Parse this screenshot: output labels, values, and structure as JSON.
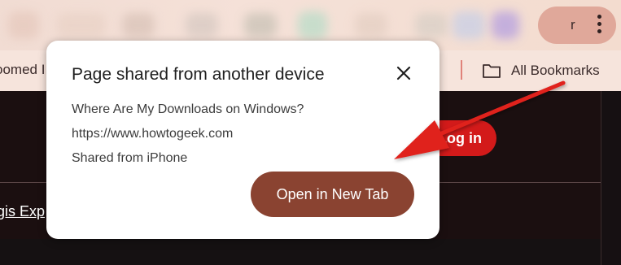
{
  "toolbar": {
    "profile_letter": "r",
    "menu_icon": "kebab-menu-icon"
  },
  "bookmarks_bar": {
    "left_partial_label": "oomed I",
    "all_bookmarks_label": "All Bookmarks",
    "all_bookmarks_icon": "folder-icon"
  },
  "page": {
    "login_label": "Log in",
    "partial_link_text": "gis Exp",
    "login_color": "#d31a1a"
  },
  "dialog": {
    "title": "Page shared from another device",
    "close_icon": "close-icon",
    "page_title": "Where Are My Downloads on Windows?",
    "url": "https://www.howtogeek.com",
    "source": "Shared from iPhone",
    "open_button_label": "Open in New Tab",
    "accent_color": "#8a4331"
  },
  "annotation": {
    "arrow_icon": "red-arrow-icon",
    "color": "#e0201e"
  }
}
